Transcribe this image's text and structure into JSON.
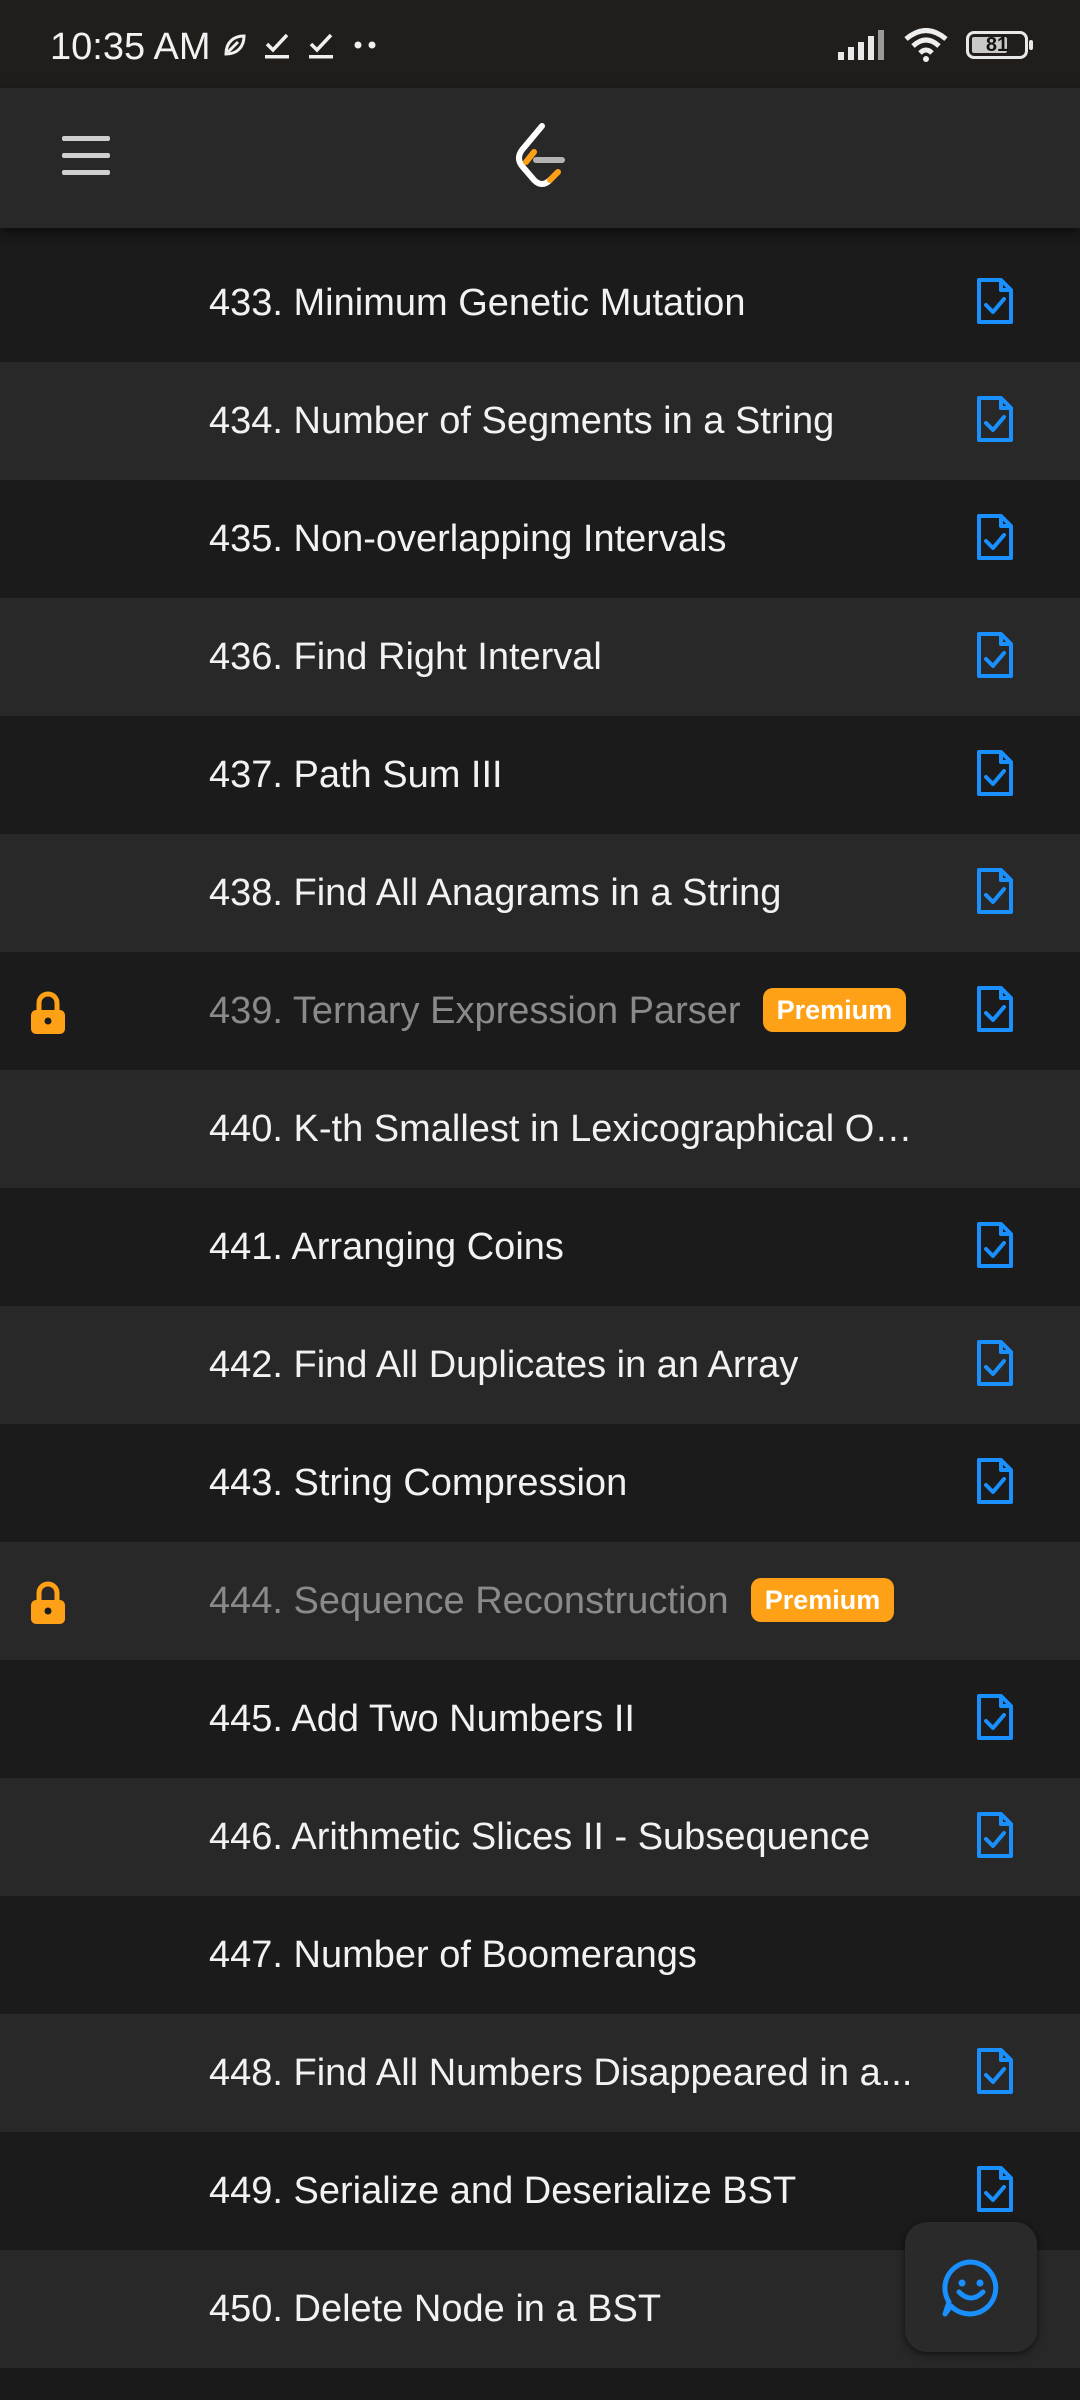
{
  "status": {
    "time": "10:35 AM",
    "battery": "81"
  },
  "app": {
    "logo_icon": "leetcode-logo-icon",
    "menu_icon": "hamburger-menu-icon"
  },
  "colors": {
    "accent_orange": "#ffa116",
    "doc_blue": "#1a90ff",
    "row_dark": "#1b1b1b",
    "row_light": "#282828"
  },
  "problems": [
    {
      "title": "433. Minimum Genetic Mutation",
      "locked": false,
      "premium": "",
      "solution": true
    },
    {
      "title": "434. Number of Segments in a String",
      "locked": false,
      "premium": "",
      "solution": true
    },
    {
      "title": "435. Non-overlapping Intervals",
      "locked": false,
      "premium": "",
      "solution": true
    },
    {
      "title": "436. Find Right Interval",
      "locked": false,
      "premium": "",
      "solution": true
    },
    {
      "title": "437. Path Sum III",
      "locked": false,
      "premium": "",
      "solution": true
    },
    {
      "title": "438. Find All Anagrams in a String",
      "locked": false,
      "premium": "",
      "solution": true
    },
    {
      "title": "439. Ternary Expression Parser",
      "locked": true,
      "premium": "Premium",
      "solution": true
    },
    {
      "title": "440. K-th Smallest in Lexicographical Or...",
      "locked": false,
      "premium": "",
      "solution": false
    },
    {
      "title": "441. Arranging Coins",
      "locked": false,
      "premium": "",
      "solution": true
    },
    {
      "title": "442. Find All Duplicates in an Array",
      "locked": false,
      "premium": "",
      "solution": true
    },
    {
      "title": "443. String Compression",
      "locked": false,
      "premium": "",
      "solution": true
    },
    {
      "title": "444. Sequence Reconstruction",
      "locked": true,
      "premium": "Premium",
      "solution": false
    },
    {
      "title": "445. Add Two Numbers II",
      "locked": false,
      "premium": "",
      "solution": true
    },
    {
      "title": "446. Arithmetic Slices II - Subsequence",
      "locked": false,
      "premium": "",
      "solution": true
    },
    {
      "title": "447. Number of Boomerangs",
      "locked": false,
      "premium": "",
      "solution": false
    },
    {
      "title": "448. Find All Numbers Disappeared in a...",
      "locked": false,
      "premium": "",
      "solution": true
    },
    {
      "title": "449. Serialize and Deserialize BST",
      "locked": false,
      "premium": "",
      "solution": true
    },
    {
      "title": "450. Delete Node in a BST",
      "locked": false,
      "premium": "",
      "solution": false
    }
  ]
}
